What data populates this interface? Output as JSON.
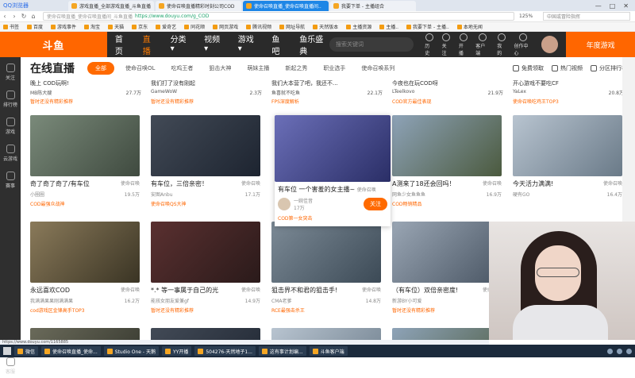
{
  "browser": {
    "name": "QQ浏览器",
    "tabs": [
      {
        "title": "游戏直播_全部游戏直播_斗鱼直播",
        "active": false
      },
      {
        "title": "使命召唤直播精彩时刻公司COD",
        "active": false
      },
      {
        "title": "使命召唤直播_使命召唤直播间..",
        "active": true
      },
      {
        "title": "我要下单 - 主播组合",
        "active": false
      }
    ],
    "address_title": "使命召唤直播_使命召唤直播间_斗鱼直播",
    "url": "https://www.douyu.com/g_COD",
    "zoom": "125%",
    "search_placeholder": "中国或冒险指挥",
    "win_buttons": [
      "—",
      "□",
      "✕"
    ]
  },
  "bookmarks": [
    "书签",
    "百度",
    "游戏事件",
    "淘宝",
    "天猫",
    "京东",
    "爱奇艺",
    "同花顺",
    "网页游戏",
    "腾讯视频",
    "网址导航",
    "天然版本",
    "主播资源",
    "主播..",
    "我要下单 - 主播..",
    "本地无闻"
  ],
  "site": {
    "logo": "斗鱼",
    "nav": [
      {
        "label": "首页",
        "active": false
      },
      {
        "label": "直播",
        "active": true
      },
      {
        "label": "分类 ▾",
        "active": false
      },
      {
        "label": "视频 ▾",
        "active": false
      },
      {
        "label": "游戏 ▾",
        "active": false
      },
      {
        "label": "鱼吧",
        "active": false
      },
      {
        "label": "鱼乐盛典",
        "active": false
      }
    ],
    "search_placeholder": "搜索关键词",
    "header_icons": [
      "历史",
      "关注",
      "开播",
      "客户端",
      "我的",
      "创作中心"
    ],
    "banner": "年度游戏"
  },
  "sidebar": [
    "关注",
    "排行榜",
    "游戏",
    "云游戏",
    "赛事",
    "客服"
  ],
  "page": {
    "title": "在线直播",
    "categories": [
      {
        "label": "全部",
        "active": true
      },
      {
        "label": "使命召唤OL",
        "active": false
      },
      {
        "label": "吃鸡王者",
        "active": false
      },
      {
        "label": "狙击大神",
        "active": false
      },
      {
        "label": "萌妹主播",
        "active": false
      },
      {
        "label": "新起之秀",
        "active": false
      },
      {
        "label": "职业选手",
        "active": false
      },
      {
        "label": "使命召唤系列",
        "active": false
      }
    ],
    "header_buttons": [
      "免费领取",
      "热门视频",
      "分区排行榜"
    ]
  },
  "top_row": [
    {
      "title": "晚上 COD玩啊!",
      "streamer": "MB陈大嫂",
      "views": "27.7万",
      "tag": "暂时还没有精彩推荐"
    },
    {
      "title": "我们打了没有刚起",
      "streamer": "GameWoW",
      "views": "2.3万",
      "tag": "暂时还没有精彩推荐"
    },
    {
      "title": "我们大本营了吧，我还不...",
      "streamer": "鱼喜就不吃鱼",
      "views": "22.1万",
      "tag": "FPS深度解析"
    },
    {
      "title": "今夜也在玩COD呀",
      "streamer": "LTeelkovo",
      "views": "21.9万",
      "tag": "COD官方最佳表现"
    },
    {
      "title": "开心游戏不要吃CF",
      "streamer": "YaLex",
      "views": "20.8万",
      "tag": "使命召唤吃鸡王TOP3"
    }
  ],
  "cards": [
    {
      "title": "奇了奇了奇了/有车位",
      "cat": "使命召唤",
      "streamer": "小圈圈",
      "views": "19.5万",
      "tag": "COD最强众战神"
    },
    {
      "title": "有车位，三倍亲密！",
      "cat": "使命召唤",
      "streamer": "安图Anbu",
      "views": "17.1万",
      "tag": "使命召唤QS大神"
    },
    {
      "title": "A测来了18还会回吗！",
      "cat": "使命召唤",
      "streamer": "网鱼少女鱼鱼鱼",
      "views": "16.9万",
      "tag": "COD畅销精品"
    },
    {
      "title": "今天活力满满!",
      "cat": "使命召唤",
      "streamer": "硬有GO",
      "views": "16.4万",
      "tag": ""
    },
    {
      "title": "永远喜欢COD",
      "cat": "使命召唤",
      "streamer": "我满满果果刚满满果",
      "views": "16.2万",
      "tag": "cod游戏区金锋高手TOP3"
    },
    {
      "title": "*.* 等一事属于自己的光",
      "cat": "使命召唤",
      "streamer": "能孩女朋友爱兼gf",
      "views": "14.9万",
      "tag": "暂时还没有精彩推荐"
    },
    {
      "title": "狙击界不和君的狙击手!",
      "cat": "使命召唤",
      "streamer": "CMA老爹",
      "views": "14.8万",
      "tag": "RCE最强击杀王"
    },
    {
      "title": "（有车位）双倍亲密度!",
      "cat": "使命召唤",
      "streamer": "新游BY小可爱",
      "views": "",
      "tag": "暂时还没有精彩推荐"
    }
  ],
  "featured": {
    "title": "有车位 一个害羞的女主播~",
    "cat": "使命召唤",
    "streamer": "一婉佳音",
    "views": "17万",
    "follow": "关注",
    "tag": "COD第一女突击"
  },
  "statusbar": "https://www.douyu.com/1165885",
  "taskbar": {
    "items": [
      "微信",
      "使命召唤直播_使命...",
      "Studio One - 天鹅",
      "YY开播",
      "504276-天然地子1...",
      "这有事计划编...",
      "斗鱼客户端"
    ]
  }
}
